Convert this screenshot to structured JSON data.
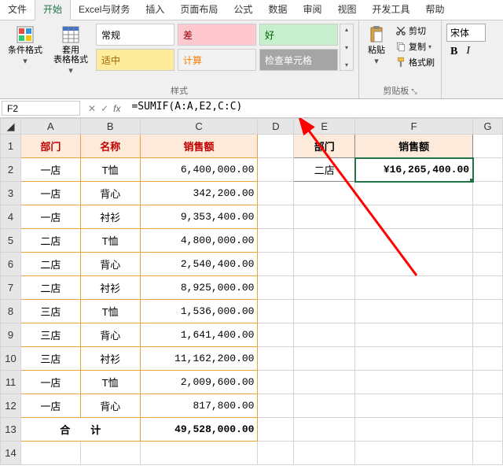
{
  "tabs": {
    "file": "文件",
    "home": "开始",
    "excelfin": "Excel与财务",
    "insert": "插入",
    "layout": "页面布局",
    "formulas": "公式",
    "data": "数据",
    "review": "审阅",
    "view": "视图",
    "dev": "开发工具",
    "help": "帮助"
  },
  "ribbon": {
    "cond_fmt": "条件格式",
    "tbl_fmt": "套用\n表格格式",
    "styles": {
      "normal": "常规",
      "bad": "差",
      "good": "好",
      "neutral": "适中",
      "calc": "计算",
      "check": "检查单元格"
    },
    "styles_lbl": "样式",
    "paste": "粘贴",
    "cut": "剪切",
    "copy": "复制",
    "painter": "格式刷",
    "clip_lbl": "剪贴板",
    "font_name": "宋体"
  },
  "namebox": "F2",
  "formula": "=SUMIF(A:A,E2,C:C)",
  "cols": {
    "A": "A",
    "B": "B",
    "C": "C",
    "D": "D",
    "E": "E",
    "F": "F",
    "G": "G"
  },
  "headers": {
    "dept": "部门",
    "name": "名称",
    "sales": "销售额"
  },
  "rows": [
    {
      "dept": "一店",
      "name": "T恤",
      "sales": "6,400,000.00"
    },
    {
      "dept": "一店",
      "name": "背心",
      "sales": "342,200.00"
    },
    {
      "dept": "一店",
      "name": "衬衫",
      "sales": "9,353,400.00"
    },
    {
      "dept": "二店",
      "name": "T恤",
      "sales": "4,800,000.00"
    },
    {
      "dept": "二店",
      "name": "背心",
      "sales": "2,540,400.00"
    },
    {
      "dept": "二店",
      "name": "衬衫",
      "sales": "8,925,000.00"
    },
    {
      "dept": "三店",
      "name": "T恤",
      "sales": "1,536,000.00"
    },
    {
      "dept": "三店",
      "name": "背心",
      "sales": "1,641,400.00"
    },
    {
      "dept": "三店",
      "name": "衬衫",
      "sales": "11,162,200.00"
    },
    {
      "dept": "一店",
      "name": "T恤",
      "sales": "2,009,600.00"
    },
    {
      "dept": "一店",
      "name": "背心",
      "sales": "817,800.00"
    }
  ],
  "total_lbl": "合　　计",
  "total_val": "49,528,000.00",
  "ef": {
    "dept_hdr": "部门",
    "sales_hdr": "销售额",
    "dept_val": "二店",
    "sales_val": "¥16,265,400.00"
  },
  "chart_data": {
    "type": "table",
    "columns": [
      "部门",
      "名称",
      "销售额"
    ],
    "rows": [
      [
        "一店",
        "T恤",
        6400000.0
      ],
      [
        "一店",
        "背心",
        342200.0
      ],
      [
        "一店",
        "衬衫",
        9353400.0
      ],
      [
        "二店",
        "T恤",
        4800000.0
      ],
      [
        "二店",
        "背心",
        2540400.0
      ],
      [
        "二店",
        "衬衫",
        8925000.0
      ],
      [
        "三店",
        "T恤",
        1536000.0
      ],
      [
        "三店",
        "背心",
        1641400.0
      ],
      [
        "三店",
        "衬衫",
        11162200.0
      ],
      [
        "一店",
        "T恤",
        2009600.0
      ],
      [
        "一店",
        "背心",
        817800.0
      ]
    ],
    "total": 49528000.0,
    "lookup": {
      "dept": "二店",
      "result": 16265400.0,
      "formula": "=SUMIF(A:A,E2,C:C)"
    }
  }
}
